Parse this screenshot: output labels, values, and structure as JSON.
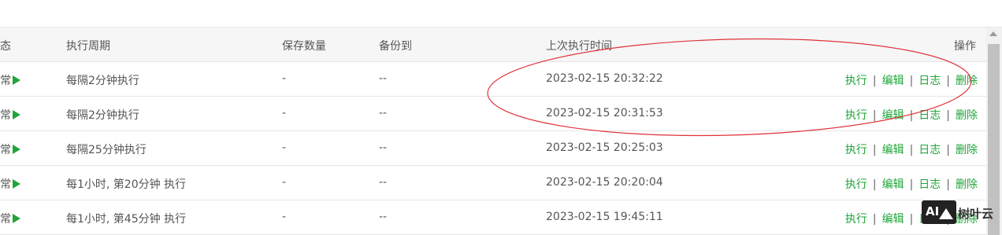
{
  "table": {
    "headers": {
      "status": "态",
      "period": "执行周期",
      "keep": "保存数量",
      "backup_to": "备份到",
      "last_run": "上次执行时间",
      "actions": "操作"
    },
    "rows": [
      {
        "status": "常",
        "period": "每隔2分钟执行",
        "keep": "-",
        "backup_to": "--",
        "last_run": "2023-02-15 20:32:22"
      },
      {
        "status": "常",
        "period": "每隔2分钟执行",
        "keep": "-",
        "backup_to": "--",
        "last_run": "2023-02-15 20:31:53"
      },
      {
        "status": "常",
        "period": "每隔25分钟执行",
        "keep": "-",
        "backup_to": "--",
        "last_run": "2023-02-15 20:25:03"
      },
      {
        "status": "常",
        "period": "每1小时, 第20分钟 执行",
        "keep": "-",
        "backup_to": "--",
        "last_run": "2023-02-15 20:20:04"
      },
      {
        "status": "常",
        "period": "每1小时, 第45分钟 执行",
        "keep": "-",
        "backup_to": "--",
        "last_run": "2023-02-15 19:45:11"
      }
    ],
    "action_labels": {
      "run": "执行",
      "edit": "编辑",
      "log": "日志",
      "delete": "删除",
      "separator": "|"
    }
  },
  "watermark": {
    "logo_text": "AI",
    "text": "树叶云"
  },
  "colors": {
    "accent": "#20a53a",
    "annotation": "#e0313a"
  },
  "icons": [
    "play-icon",
    "annotation-ellipse",
    "watermark-logo"
  ]
}
